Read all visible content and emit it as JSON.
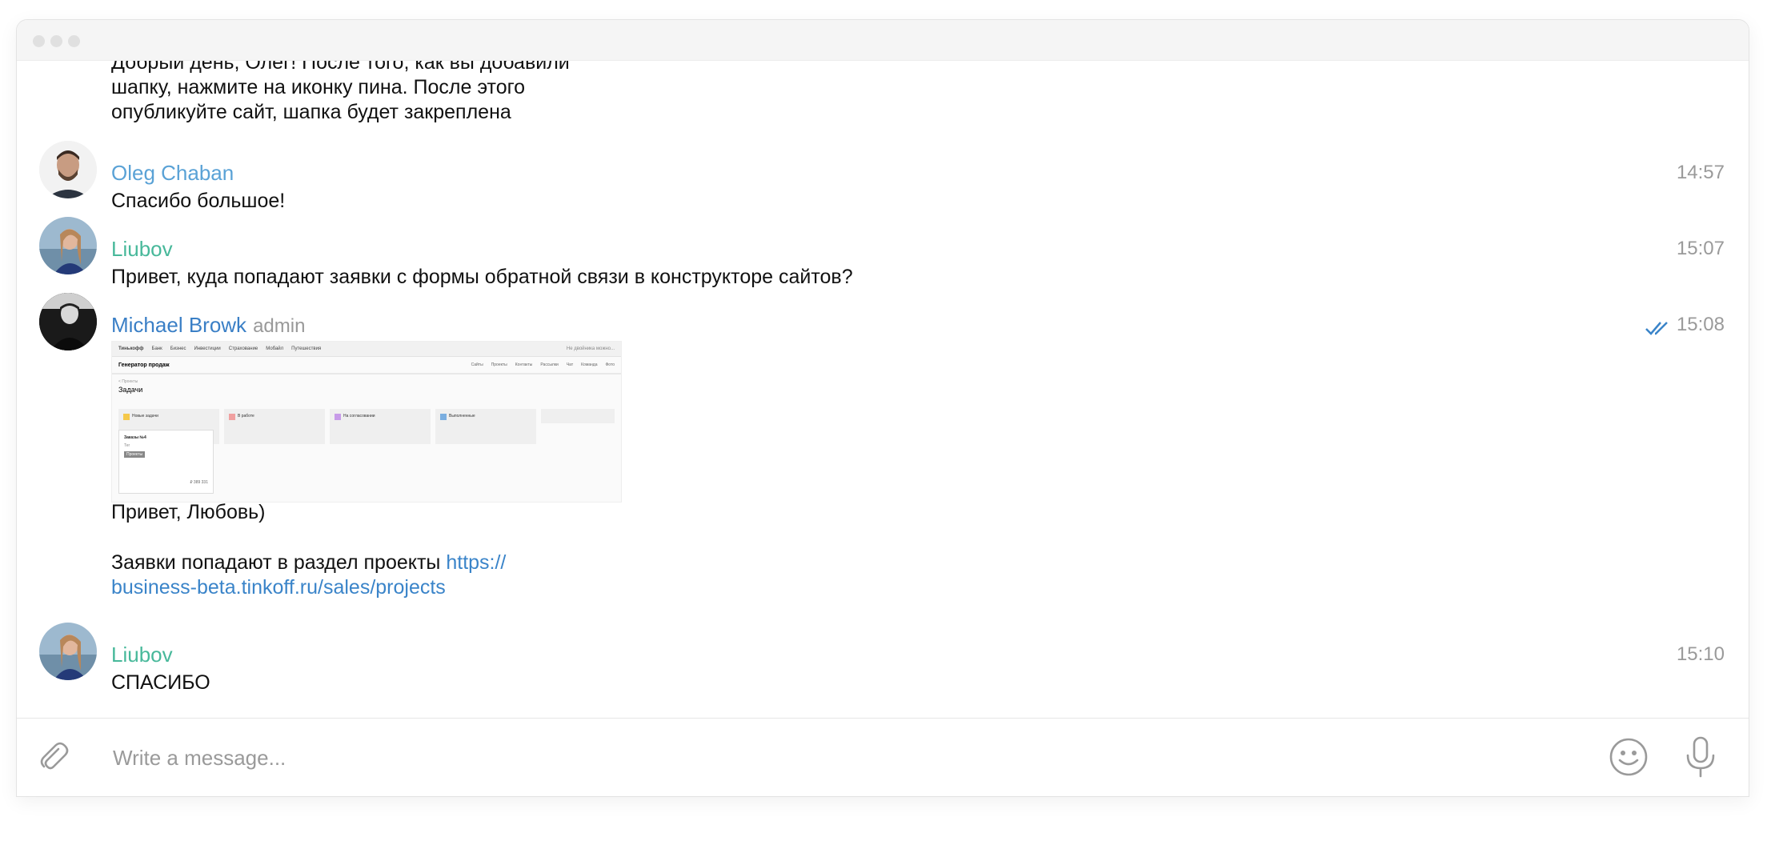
{
  "colors": {
    "name_oleg": "#5aa2d6",
    "name_liubov": "#47b89a",
    "name_michael": "#3a7fc6",
    "link": "#3a84c9",
    "read_check": "#3a84c9"
  },
  "messages": [
    {
      "text_lines": [
        "Добрый день, Олег! После того, как вы добавили",
        "шапку, нажмите на иконку пина. После этого",
        "опубликуйте сайт, шапка будет закреплена"
      ]
    },
    {
      "author": "Oleg Chaban",
      "time": "14:57",
      "text": "Спасибо большое!",
      "avatar_icon": "user-photo"
    },
    {
      "author": "Liubov",
      "time": "15:07",
      "text": "Привет, куда попадают заявки с формы обратной связи в конструкторе сайтов?",
      "avatar_icon": "user-photo"
    },
    {
      "author": "Michael Browk",
      "role": "admin",
      "time": "15:08",
      "status_icon": "double-check-icon",
      "attachment": {
        "brand": "Тинькофф",
        "nav_items": [
          "Банк",
          "Бизнес",
          "Инвестиции",
          "Страхование",
          "Мобайл",
          "Путешествия"
        ],
        "search_text": "Не двойника можно...",
        "app_title": "Генератор продаж",
        "tabs": [
          "Сайты",
          "Проекты",
          "Контакты",
          "Рассылки",
          "Чат",
          "Команда",
          "Фото"
        ],
        "crumb": "< Проекты",
        "page_title": "Задачи",
        "columns": [
          "Новые задачи",
          "В работе",
          "На согласовании",
          "Выполненные"
        ],
        "card": {
          "title": "Заказы №4",
          "tag_label": "Тег",
          "tag": "Проекты",
          "amount": "₽ 389 331"
        }
      },
      "text_greeting": "Привет, Любовь)",
      "text_prefix": "Заявки попадают в раздел проекты ",
      "link_line1": "https://",
      "link_line2": "business-beta.tinkoff.ru/sales/projects"
    },
    {
      "author": "Liubov",
      "time": "15:10",
      "text": "СПАСИБО",
      "avatar_icon": "user-photo"
    }
  ],
  "composer": {
    "placeholder": "Write a message...",
    "attach_icon": "paperclip-icon",
    "emoji_icon": "emoji-icon",
    "mic_icon": "microphone-icon"
  }
}
